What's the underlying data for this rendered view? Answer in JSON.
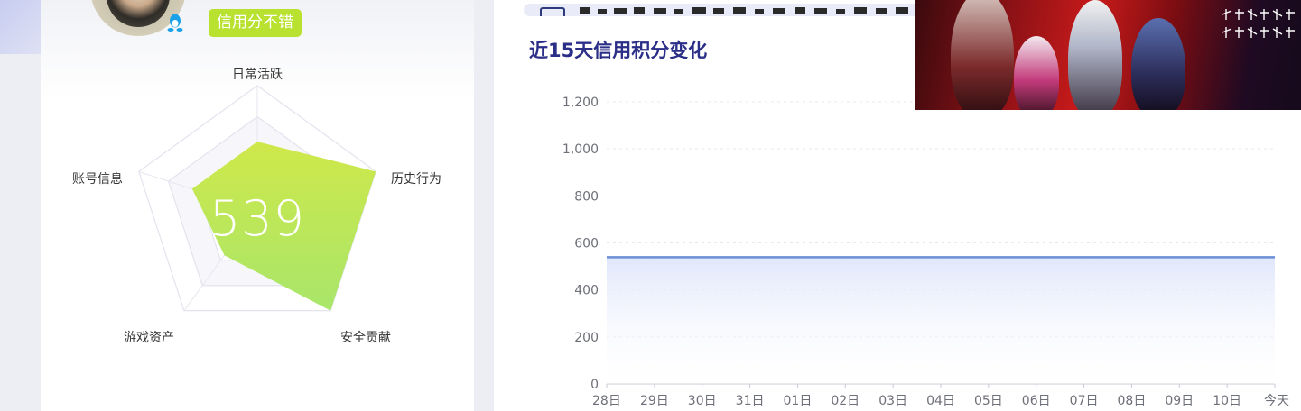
{
  "profile": {
    "credit_badge": "信用分不错",
    "score": "539"
  },
  "radar": {
    "labels": [
      "日常活跃",
      "历史行为",
      "安全贡献",
      "游戏资产",
      "账号信息"
    ],
    "values": [
      0.55,
      1.0,
      1.0,
      0.45,
      0.55
    ],
    "color_top": "#cfe84a",
    "color_bottom": "#a8e66a"
  },
  "chart_title": "近15天信用积分变化",
  "chart_data": {
    "type": "area",
    "title": "近15天信用积分变化",
    "categories": [
      "28日",
      "29日",
      "30日",
      "31日",
      "01日",
      "02日",
      "03日",
      "04日",
      "05日",
      "06日",
      "07日",
      "08日",
      "09日",
      "10日",
      "今天"
    ],
    "series": [
      {
        "values": [
          539,
          539,
          539,
          539,
          539,
          539,
          539,
          539,
          539,
          539,
          539,
          539,
          539,
          539,
          539
        ]
      }
    ],
    "yticks": [
      0,
      200,
      400,
      600,
      800,
      1000,
      1200
    ],
    "ytick_labels": [
      "0",
      "200",
      "400",
      "600",
      "800",
      "1,000",
      "1,200"
    ],
    "ylim": [
      0,
      1200
    ],
    "grid": true,
    "line_color": "#6b8fd6",
    "fill_color": "#dfe6fb"
  }
}
